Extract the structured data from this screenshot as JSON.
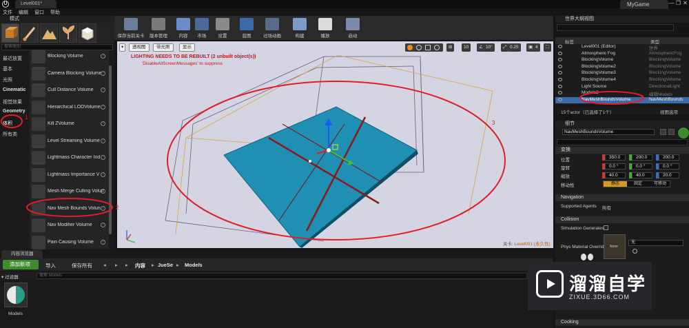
{
  "window": {
    "tab_title": "Level001*",
    "project_name": "MyGame",
    "controls": [
      "—",
      "❐",
      "✕"
    ]
  },
  "menu": [
    "文件",
    "编辑",
    "窗口",
    "帮助"
  ],
  "modes": {
    "title": "模式",
    "search_placeholder": "搜索类别",
    "categories": [
      "最近放置",
      "基本",
      "光照",
      "Cinematic",
      "视觉效果",
      "Geometry",
      "体积",
      "所有类"
    ],
    "selected_category": "体积",
    "assets": [
      "Blocking Volume",
      "Camera Blocking Volume",
      "Cull Distance Volume",
      "Hierarchical LODVolume",
      "Kill ZVolume",
      "Level Streaming Volume",
      "Lightmass Character Ind",
      "Lightmass Importance V",
      "Mesh Merge Culling Volume",
      "Nav Mesh Bounds Volun",
      "Nav Modifier Volume",
      "Pain Causing Volume"
    ],
    "help_glyph": "?"
  },
  "toolbar": {
    "buttons": [
      "保存当前关卡",
      "版本管理",
      "内容",
      "市场",
      "设置",
      "蓝图",
      "过场动画",
      "构建",
      "播放",
      "启动"
    ],
    "dropdown_glyph": "▾"
  },
  "viewport": {
    "menu_glyph": "▾",
    "view_mode": "透视图",
    "lit_mode": "带光照",
    "show": "显示",
    "grid_snap": "10",
    "rotation_snap": "10°",
    "scale_snap": "0.25",
    "camera_speed": "4",
    "lighting_warning": "LIGHTING NEEDS TO BE REBUILT (2 unbuilt object(s))",
    "warning_sub": "'DisableAllScreenMessages' to suppress",
    "level_label": "关卡:",
    "level_value": "Level001 (永久性)"
  },
  "outliner": {
    "title": "世界大纲视图",
    "columns": [
      "标签",
      "类型"
    ],
    "rows": [
      {
        "name": "Level001 (Editor)",
        "type": "世界"
      },
      {
        "name": "Atmospheric Fog",
        "type": "AtmosphericFog"
      },
      {
        "name": "BlockingVolume",
        "type": "BlockingVolume"
      },
      {
        "name": "BlockingVolume2",
        "type": "BlockingVolume"
      },
      {
        "name": "BlockingVolume3",
        "type": "BlockingVolume"
      },
      {
        "name": "BlockingVolume4",
        "type": "BlockingVolume"
      },
      {
        "name": "Light Source",
        "type": "DirectionalLight"
      },
      {
        "name": "Models2",
        "type": "编辑Models"
      },
      {
        "name": "NavMeshBoundsVolume",
        "type": "NavMeshBounds"
      }
    ],
    "selected_row": "NavMeshBoundsVolume",
    "footer_count": "15个actor（已选择了1个）",
    "footer_view": "视图选项"
  },
  "details": {
    "title": "细节",
    "actor_name": "NavMeshBoundsVolume",
    "transform_section": "变换",
    "location_label": "位置",
    "rotation_label": "旋转",
    "scale_label": "缩放",
    "mobility_label": "移动性",
    "location": [
      "350.0",
      "200.0",
      "200.0"
    ],
    "rotation": [
      "0.0 °",
      "0.0 °",
      "0.0 °"
    ],
    "scale": [
      "40.0",
      "40.0",
      "20.0"
    ],
    "mobility": [
      "静态",
      "固定",
      "可移动"
    ],
    "navigation_section": "Navigation",
    "supported_agents_label": "Supported Agents",
    "supported_agents_value": "所有",
    "collision_section": "Collision",
    "sim_generates_label": "Simulation Generates",
    "phys_material_label": "Phys Material Overrid",
    "phys_material_value": "无",
    "phys_thumb_label": "None",
    "cooking_section": "Cooking"
  },
  "content_browser": {
    "tab": "内容浏览器",
    "add_new": "添加新项",
    "import": "导入",
    "save_all": "保存所有",
    "breadcrumbs": [
      "内容",
      "JueSe",
      "Models"
    ],
    "filter": "过滤器",
    "search_placeholder": "搜索 Models",
    "asset_label": "Models"
  },
  "watermark": {
    "title": "溜溜自学",
    "subtitle": "ZIXUE.3D66.COM"
  },
  "annotations": [
    "1",
    "2",
    "3"
  ],
  "colors": {
    "accent_blue": "#3d6aa8",
    "add_green": "#3f8a2b",
    "warning_red": "#c0181e",
    "annotation_red": "#e21d2a",
    "floor_blue": "#1f8fb3"
  }
}
